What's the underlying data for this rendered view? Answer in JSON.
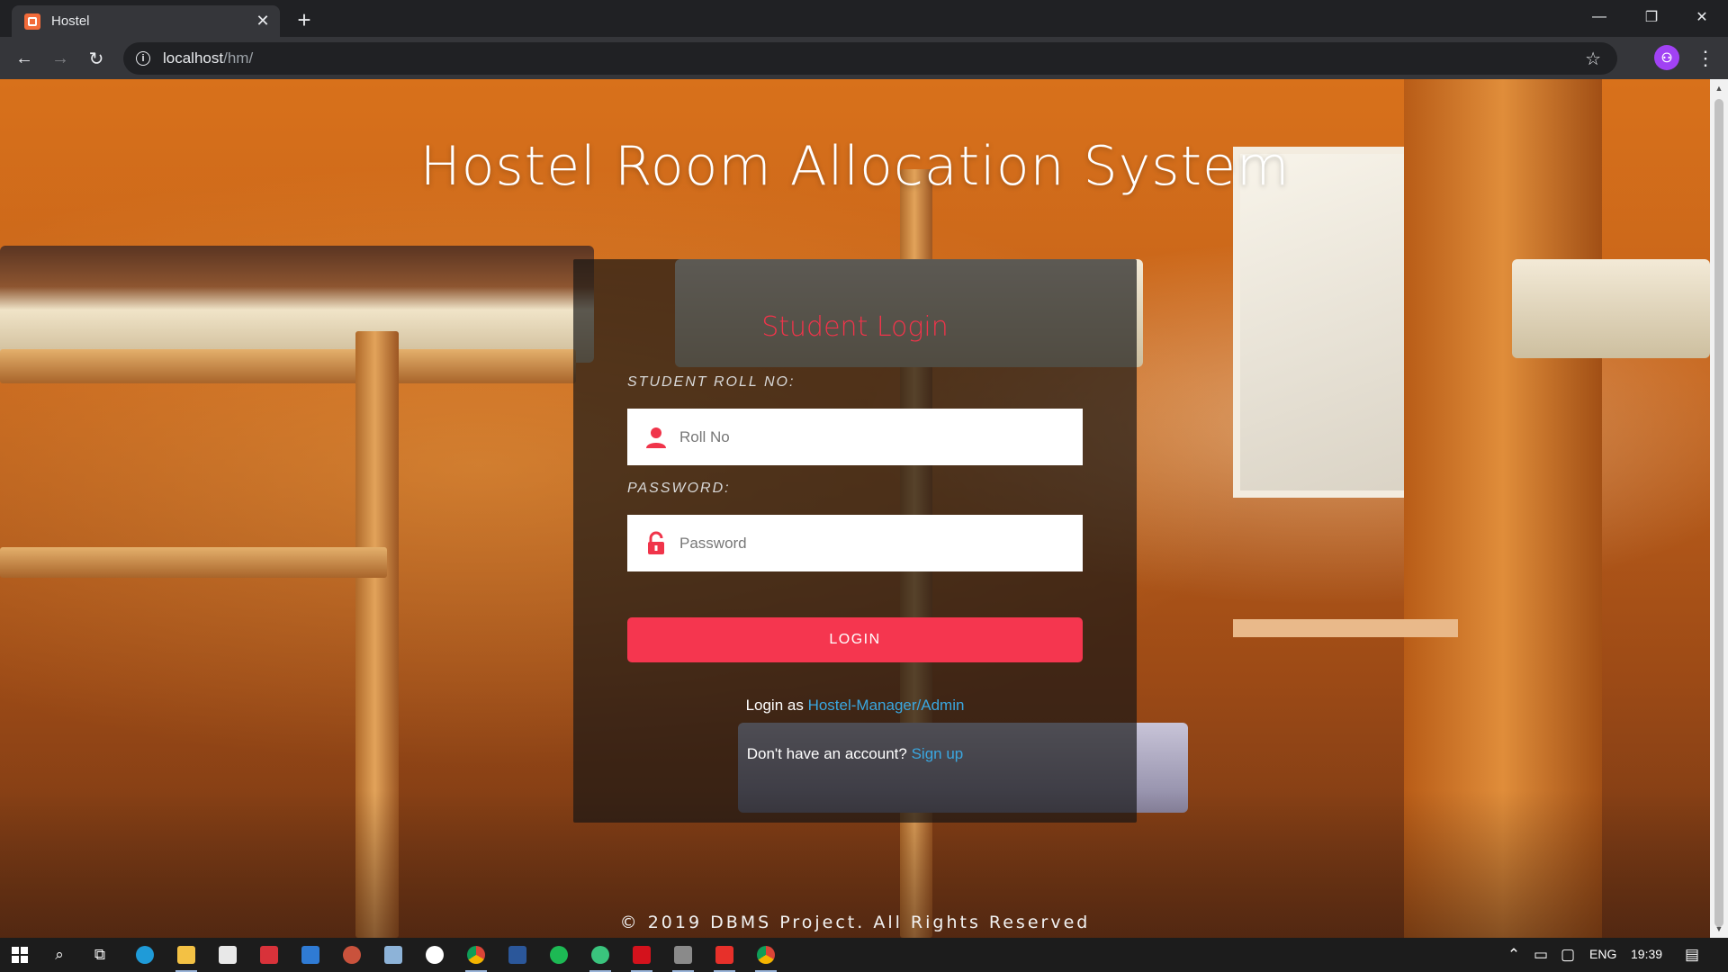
{
  "browser": {
    "tab_title": "Hostel",
    "tab_close": "✕",
    "new_tab": "+",
    "url_host": "localhost",
    "url_path": "/hm/",
    "profile_initial": "⚇"
  },
  "page": {
    "title": "Hostel Room Allocation System",
    "login_card": {
      "heading": "Student Login",
      "roll_label": "STUDENT ROLL NO:",
      "roll_placeholder": "Roll No",
      "password_label": "PASSWORD:",
      "password_placeholder": "Password",
      "login_button": "LOGIN",
      "admin_prefix": "Login as",
      "admin_link": "Hostel-Manager/Admin",
      "signup_prefix": "Don't have an account?",
      "signup_link": "Sign up"
    },
    "footer": "© 2019 DBMS Project. All Rights Reserved"
  },
  "taskbar": {
    "language": "ENG",
    "time": "19:39"
  },
  "colors": {
    "accent": "#f5364f",
    "heading": "#f0344a",
    "link": "#3aa7e0"
  }
}
